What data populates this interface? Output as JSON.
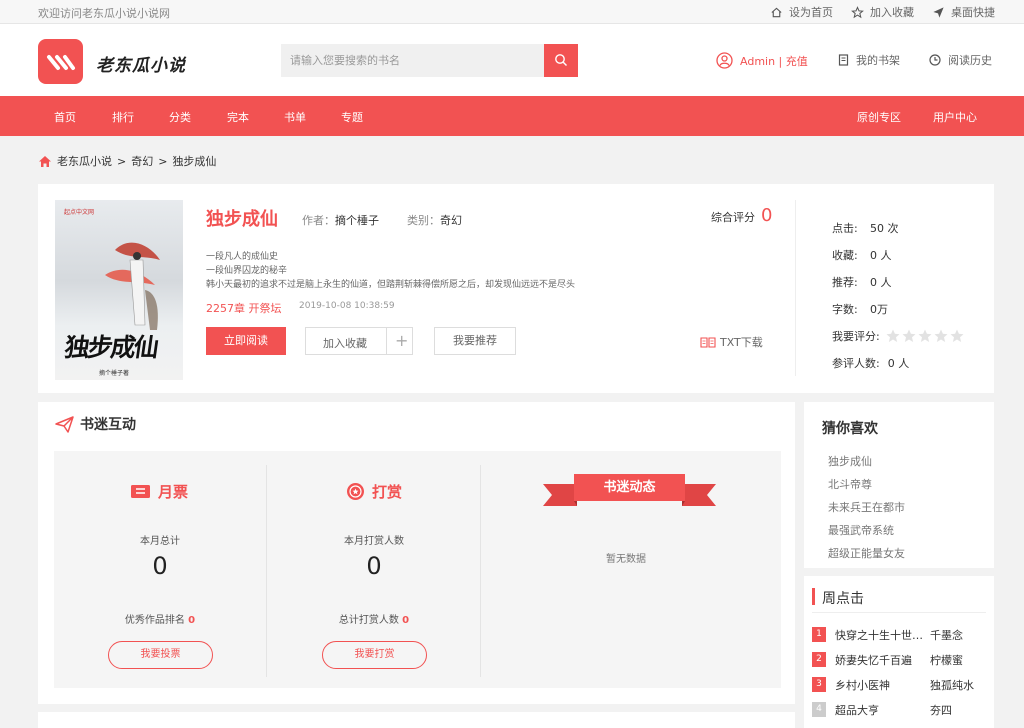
{
  "topbar": {
    "welcome": "欢迎访问老东瓜小说小说网",
    "links": [
      "设为首页",
      "加入收藏",
      "桌面快捷"
    ]
  },
  "header": {
    "logo_text": "老东瓜小说",
    "search_placeholder": "请输入您要搜索的书名",
    "user": "Admin | 充值",
    "shelf": "我的书架",
    "history": "阅读历史"
  },
  "nav": {
    "items": [
      "首页",
      "排行",
      "分类",
      "完本",
      "书单",
      "专题"
    ],
    "right": [
      "原创专区",
      "用户中心"
    ]
  },
  "breadcrumb": {
    "home": "老东瓜小说",
    "sep": ">",
    "category": "奇幻",
    "book": "独步成仙"
  },
  "book": {
    "title": "独步成仙",
    "author_label": "作者：",
    "author": "摘个棰子",
    "category_label": "类别：",
    "category": "奇幻",
    "score_label": "综合评分",
    "score": "0",
    "intro": [
      "一段凡人的成仙史",
      "一段仙界囚龙的秘辛",
      "韩小天最初的追求不过是脑上永生的仙道，但踏荆斩棘得偿所愿之后，却发现仙远远不是尽头"
    ],
    "latest": "2257章 开祭坛",
    "latest_time": "2019-10-08 10:38:59",
    "cover_publisher": "起点中文网",
    "cover_title": "独步成仙",
    "cover_author": "摘个棰子著",
    "buttons": {
      "read": "立即阅读",
      "collect": "加入收藏",
      "plus": "+",
      "recommend": "我要推荐",
      "txt": "TXT下载"
    },
    "stats": [
      {
        "label": "点击:",
        "value": "50 次"
      },
      {
        "label": "收藏:",
        "value": "0 人"
      },
      {
        "label": "推荐:",
        "value": "0 人"
      },
      {
        "label": "字数:",
        "value": "0万"
      }
    ],
    "rate_label": "我要评分:",
    "rating": 0,
    "voters_label": "参评人数:",
    "voters": "0 人"
  },
  "interaction": {
    "title": "书迷互动",
    "monthly": {
      "title": "月票",
      "sub": "本月总计",
      "num": "0",
      "rank_label": "优秀作品排名",
      "rank": "0",
      "button": "我要投票"
    },
    "reward": {
      "title": "打赏",
      "sub": "本月打赏人数",
      "num": "0",
      "rank_label": "总计打赏人数",
      "rank": "0",
      "button": "我要打赏"
    },
    "fans": {
      "title": "书迷动态",
      "empty": "暂无数据"
    }
  },
  "sidebar": {
    "guess_title": "猜你喜欢",
    "guess": [
      "独步成仙",
      "北斗帝尊",
      "未来兵王在都市",
      "最强武帝系统",
      "超级正能量女友"
    ],
    "weekly_title": "周点击",
    "weekly": [
      {
        "rank": "1",
        "name": "快穿之十生十世…",
        "author": "千墨念"
      },
      {
        "rank": "2",
        "name": "娇妻失忆千百遍",
        "author": "柠檬蜜"
      },
      {
        "rank": "3",
        "name": "乡村小医神",
        "author": "独孤纯水"
      },
      {
        "rank": "4",
        "name": "超品大亨",
        "author": "夯四"
      }
    ]
  },
  "colors": {
    "accent": "#f25252",
    "rank_top": "#f25252",
    "rank_other": "#cccccc"
  }
}
